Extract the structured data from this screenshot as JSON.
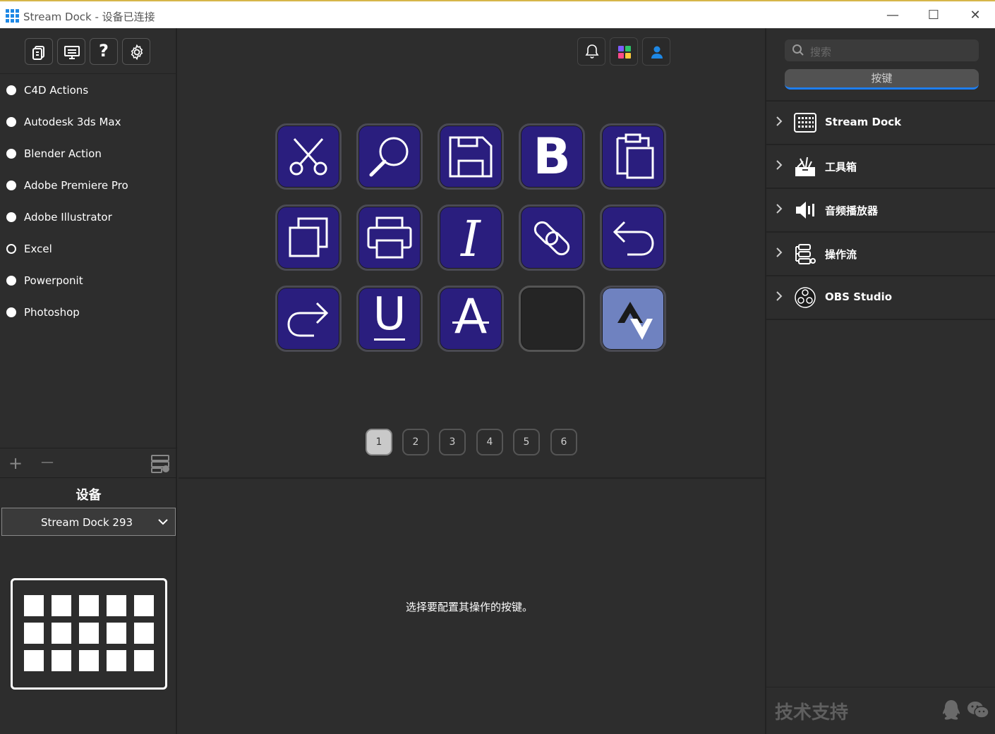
{
  "window": {
    "title": "Stream Dock - 设备已连接",
    "minimize": "—",
    "maximize": "☐",
    "close": "✕"
  },
  "left_toolbar": {
    "icons": [
      "switch-device-icon",
      "present-icon",
      "help-icon",
      "settings-icon"
    ],
    "help_glyph": "?"
  },
  "profiles": [
    {
      "label": "C4D Actions",
      "selected": true
    },
    {
      "label": "Autodesk 3ds Max",
      "selected": true
    },
    {
      "label": "Blender  Action",
      "selected": true
    },
    {
      "label": "Adobe Premiere Pro",
      "selected": true
    },
    {
      "label": "Adobe Illustrator",
      "selected": true
    },
    {
      "label": "Excel",
      "selected": false
    },
    {
      "label": "Powerponit",
      "selected": true
    },
    {
      "label": "Photoshop",
      "selected": true
    }
  ],
  "profile_actions": {
    "add": "+",
    "remove": "—"
  },
  "device": {
    "title": "设备",
    "selected": "Stream Dock 293",
    "preview_keys": 15
  },
  "keys": [
    {
      "icon": "scissors-icon",
      "style": "dark"
    },
    {
      "icon": "search-icon",
      "style": "dark"
    },
    {
      "icon": "save-icon",
      "style": "dark"
    },
    {
      "icon": "bold-icon",
      "style": "dark",
      "glyph": "B"
    },
    {
      "icon": "paste-icon",
      "style": "dark"
    },
    {
      "icon": "copy-icon",
      "style": "dark"
    },
    {
      "icon": "print-icon",
      "style": "dark"
    },
    {
      "icon": "italic-icon",
      "style": "dark",
      "glyph": "I"
    },
    {
      "icon": "link-icon",
      "style": "dark"
    },
    {
      "icon": "undo-icon",
      "style": "dark"
    },
    {
      "icon": "redo-icon",
      "style": "dark"
    },
    {
      "icon": "underline-icon",
      "style": "dark",
      "glyph": "U"
    },
    {
      "icon": "strikethrough-icon",
      "style": "dark",
      "glyph": "A"
    },
    {
      "icon": "empty",
      "style": "empty"
    },
    {
      "icon": "page-switch-icon",
      "style": "light"
    }
  ],
  "pages": {
    "items": [
      "1",
      "2",
      "3",
      "4",
      "5",
      "6"
    ],
    "active": "1"
  },
  "hint": "选择要配置其操作的按键。",
  "right": {
    "search_placeholder": "搜索",
    "tab": "按键",
    "categories": [
      {
        "label": "Stream Dock",
        "icon": "stream-dock-icon"
      },
      {
        "label": "工具箱",
        "icon": "toolbox-icon"
      },
      {
        "label": "音频播放器",
        "icon": "audio-player-icon"
      },
      {
        "label": "操作流",
        "icon": "workflow-icon"
      },
      {
        "label": "OBS Studio",
        "icon": "obs-icon"
      }
    ],
    "support": "技术支持",
    "support_icons": [
      "qq-icon",
      "wechat-icon"
    ]
  },
  "colors": {
    "key_dark": "#2a1e7e",
    "key_light": "#6f82c0",
    "accent_blue": "#1e7ef0"
  }
}
